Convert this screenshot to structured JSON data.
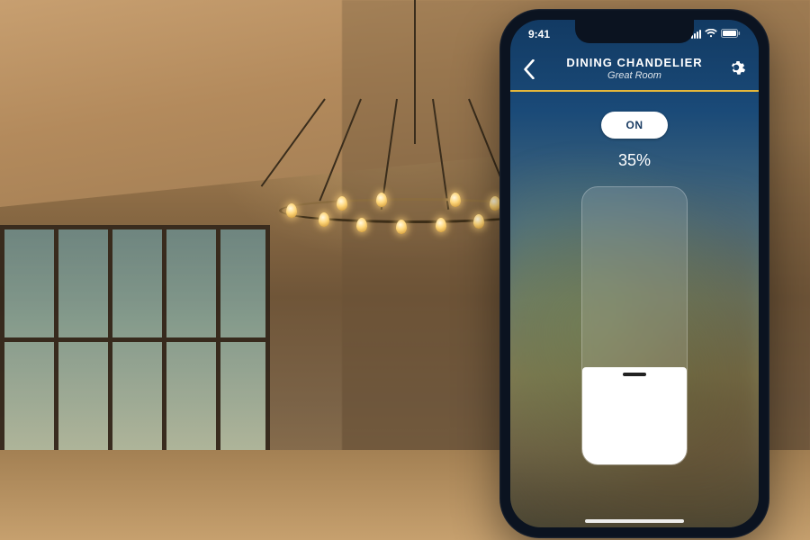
{
  "colors": {
    "accent": "#e5b83a",
    "navy": "#123a63"
  },
  "statusbar": {
    "time": "9:41"
  },
  "nav": {
    "title": "DINING CHANDELIER",
    "subtitle": "Great Room"
  },
  "control": {
    "power_label": "ON",
    "brightness_percent": 35,
    "brightness_label": "35%"
  }
}
